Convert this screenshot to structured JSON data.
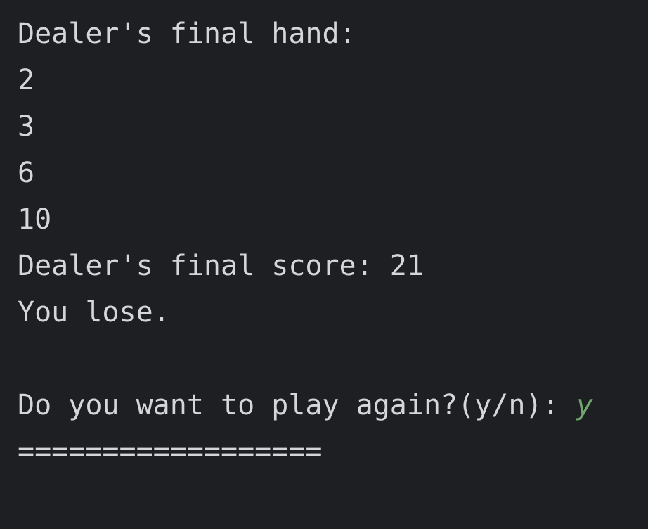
{
  "console": {
    "lines": [
      {
        "text": "Dealer's final hand:"
      },
      {
        "text": "2"
      },
      {
        "text": "3"
      },
      {
        "text": "6"
      },
      {
        "text": "10"
      },
      {
        "text": "Dealer's final score: 21"
      },
      {
        "text": "You lose."
      },
      {
        "text": ""
      },
      {
        "text": "Do you want to play again?(y/n): ",
        "input": "y"
      },
      {
        "text": "=================="
      }
    ]
  },
  "colors": {
    "background": "#1e1f22",
    "text": "#d4d6da",
    "user_input": "#72a66f"
  }
}
